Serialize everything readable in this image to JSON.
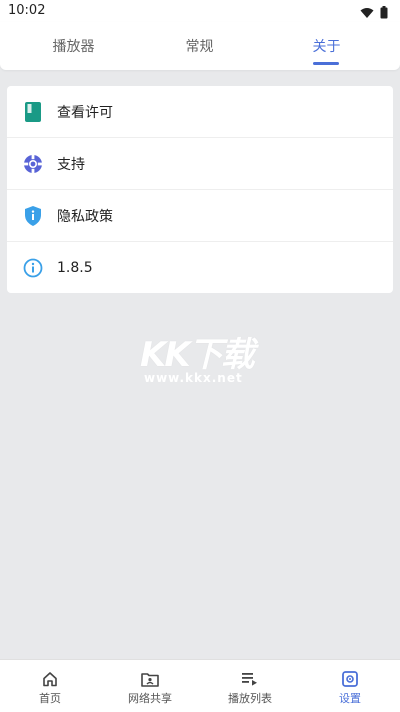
{
  "status_bar": {
    "time": "10:02",
    "icons": [
      "wifi-icon",
      "battery-icon"
    ]
  },
  "tabs": [
    {
      "label": "播放器",
      "active": false
    },
    {
      "label": "常规",
      "active": false
    },
    {
      "label": "关于",
      "active": true
    }
  ],
  "about_list": [
    {
      "label": "查看许可",
      "icon": "license-book-icon",
      "icon_color": "#1a9a86"
    },
    {
      "label": "支持",
      "icon": "lifebuoy-support-icon",
      "icon_color": "#5863d6"
    },
    {
      "label": "隐私政策",
      "icon": "privacy-shield-icon",
      "icon_color": "#3aa0e8"
    },
    {
      "label": "1.8.5",
      "icon": "info-icon",
      "icon_color": "#3aa0e8"
    }
  ],
  "watermark": {
    "title": "KK下载",
    "url": "www.kkx.net"
  },
  "bottom_nav": [
    {
      "label": "首页",
      "icon": "home-icon",
      "active": false
    },
    {
      "label": "网络共享",
      "icon": "network-share-folder-icon",
      "active": false
    },
    {
      "label": "播放列表",
      "icon": "playlist-icon",
      "active": false
    },
    {
      "label": "设置",
      "icon": "settings-gear-icon",
      "active": true
    }
  ],
  "colors": {
    "accent": "#4a6fd8",
    "background": "#e8e9eb",
    "surface": "#ffffff"
  }
}
